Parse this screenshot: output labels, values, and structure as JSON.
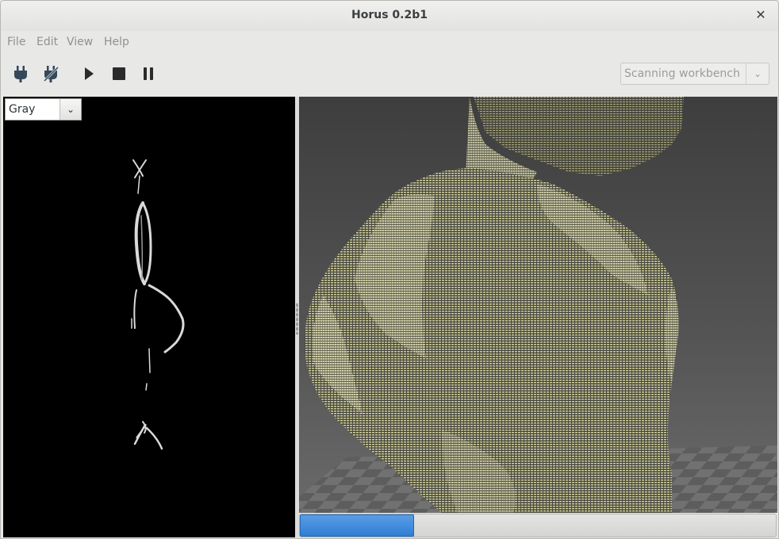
{
  "window": {
    "title": "Horus 0.2b1",
    "close_glyph": "✕"
  },
  "menu": {
    "items": [
      "File",
      "Edit",
      "View",
      "Help"
    ]
  },
  "toolbar": {
    "tools": [
      {
        "name": "connect-icon"
      },
      {
        "name": "disconnect-icon"
      },
      {
        "name": "play-icon"
      },
      {
        "name": "stop-icon"
      },
      {
        "name": "pause-icon"
      }
    ],
    "workbench": {
      "value": "Scanning workbench",
      "arrow": "⌄"
    }
  },
  "video_panel": {
    "mode": {
      "value": "Gray",
      "arrow": "⌄"
    }
  },
  "scene_panel": {
    "colors": {
      "background": "#4c4c4c",
      "floor_light": "#6f6f6f",
      "floor_dark": "#5a5a5a",
      "points": "#d8d7a3"
    }
  },
  "progress": {
    "value_percent": 24,
    "color": "#2f7dd3"
  }
}
